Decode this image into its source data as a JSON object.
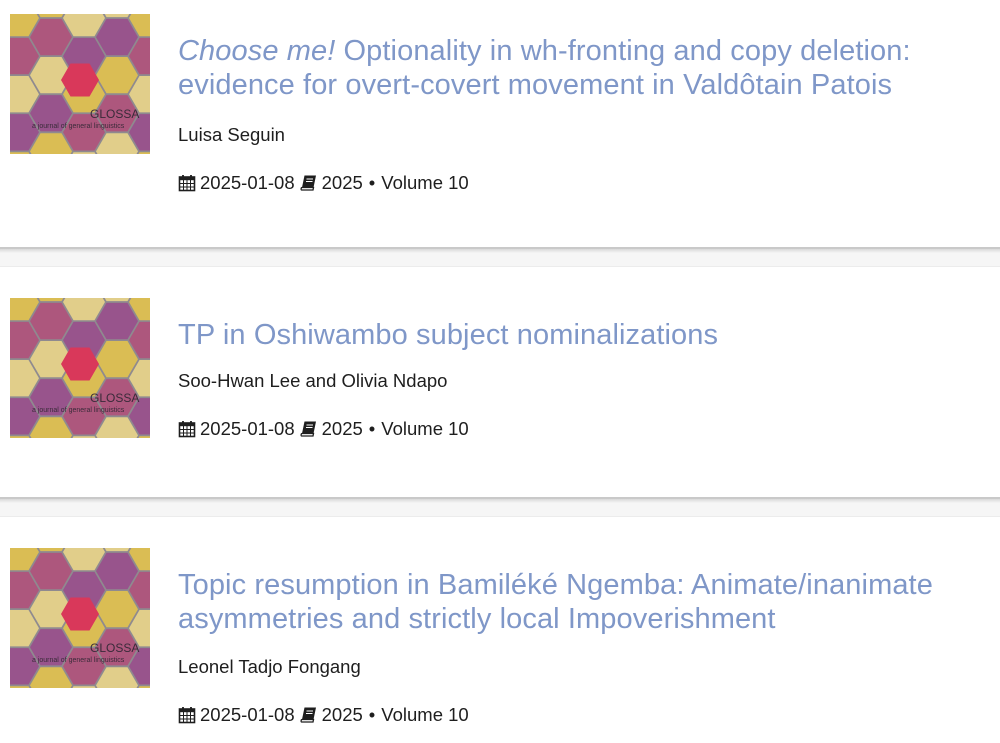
{
  "journal_cover": {
    "name": "GLOSSA",
    "tagline": "a journal of general linguistics",
    "icon": "journal-cover-image"
  },
  "articles": [
    {
      "title_em": "Choose me!",
      "title_rest": " Optionality in wh-fronting and copy deletion: evidence for overt-covert movement in Valdôtain Patois",
      "authors": "Luisa Seguin",
      "date": "2025-01-08",
      "year": "2025",
      "dot": "•",
      "volume": "Volume 10"
    },
    {
      "title": "TP in Oshiwambo subject nominalizations",
      "authors": "Soo-Hwan Lee and Olivia Ndapo",
      "date": "2025-01-08",
      "year": "2025",
      "dot": "•",
      "volume": "Volume 10"
    },
    {
      "title": "Topic resumption in Bamiléké Ngemba: Animate/inanimate asymmetries and strictly local Impoverishment",
      "authors": "Leonel Tadjo Fongang",
      "date": "2025-01-08",
      "year": "2025",
      "dot": "•",
      "volume": "Volume 10"
    }
  ],
  "icons": {
    "date": "calendar-icon",
    "issue": "book-icon"
  },
  "colors": {
    "title_link": "#7f97c8",
    "text": "#1e1e1e",
    "cover_background": "#8f8a8f"
  }
}
